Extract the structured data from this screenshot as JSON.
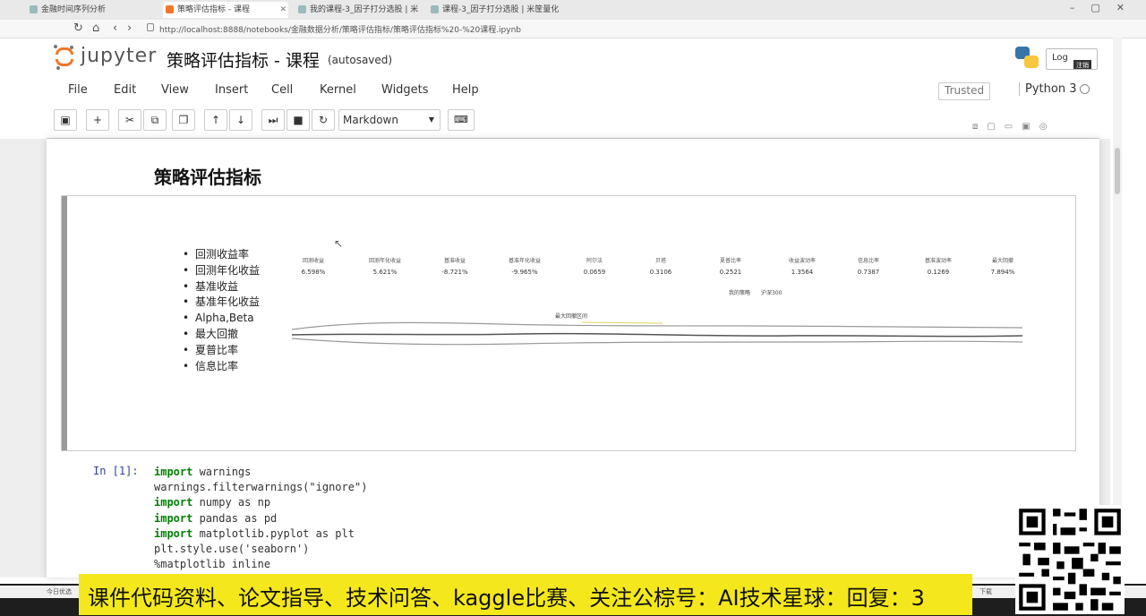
{
  "browser": {
    "tabs": [
      {
        "title": "金融时间序列分析"
      },
      {
        "title": "策略评估指标 - 课程"
      },
      {
        "title": "我的课程-3_因子打分选股 | 米"
      },
      {
        "title": "课程-3_因子打分选股 | 米筐量化"
      }
    ],
    "url": "http://localhost:8888/notebooks/金融数据分析/策略评估指标/策略评估指标%20-%20课程.ipynb"
  },
  "jupyter": {
    "logo_text": "jupyter",
    "notebook_title": "策略评估指标 - 课程",
    "autosave_status": "(autosaved)",
    "logout_label": "Log",
    "logout_tooltip": "注销",
    "trusted_label": "Trusted",
    "kernel_name": "Python 3"
  },
  "menu": [
    "File",
    "Edit",
    "View",
    "Insert",
    "Cell",
    "Kernel",
    "Widgets",
    "Help"
  ],
  "toolbar": {
    "cell_type": "Markdown",
    "buttons": [
      "save-icon",
      "add-icon",
      "cut-icon",
      "copy-icon",
      "paste-icon",
      "move-up-icon",
      "move-down-icon",
      "run-icon",
      "interrupt-icon",
      "restart-icon",
      "keyboard-icon"
    ]
  },
  "notebook": {
    "heading": "策略评估指标",
    "bullets": [
      "回测收益率",
      "回测年化收益",
      "基准收益",
      "基准年化收益",
      "Alpha,Beta",
      "最大回撤",
      "夏普比率",
      "信息比率"
    ],
    "embedded_metrics": [
      {
        "label": "回测收益",
        "value": "6.598%"
      },
      {
        "label": "回测年化收益",
        "value": "5.621%"
      },
      {
        "label": "基准收益",
        "value": "-8.721%"
      },
      {
        "label": "基准年化收益",
        "value": "-9.965%"
      },
      {
        "label": "阿尔法",
        "value": "0.0659"
      },
      {
        "label": "贝塔",
        "value": "0.3106"
      },
      {
        "label": "夏普比率",
        "value": "0.2521"
      },
      {
        "label": "收益波动率",
        "value": "1.3564"
      },
      {
        "label": "信息比率",
        "value": "0.7387"
      },
      {
        "label": "基准波动率",
        "value": "0.1269"
      },
      {
        "label": "最大回撤",
        "value": "7.894%"
      }
    ],
    "embedded_legend": [
      "我的策略",
      "沪深300"
    ],
    "embedded_chart_title": "最大回撤区间",
    "code_prompt": "In  [1]:",
    "code_lines": [
      {
        "kw": "import",
        "rest": " warnings"
      },
      {
        "kw": "",
        "rest": "warnings.filterwarnings(\"ignore\")"
      },
      {
        "kw": "import",
        "rest": " numpy as np"
      },
      {
        "kw": "import",
        "rest": " pandas as pd"
      },
      {
        "kw": "import",
        "rest": " matplotlib.pyplot as plt"
      },
      {
        "kw": "",
        "rest": "plt.style.use('seaborn')"
      },
      {
        "kw": "",
        "rest": "%matplotlib inline"
      }
    ]
  },
  "overlay": {
    "banner_text": "课件代码资料、论文指导、技术问答、kaggle比赛、关注公棕号：AI技术星球：回复：3",
    "status_left": "今日优选",
    "status_right": "下载"
  }
}
